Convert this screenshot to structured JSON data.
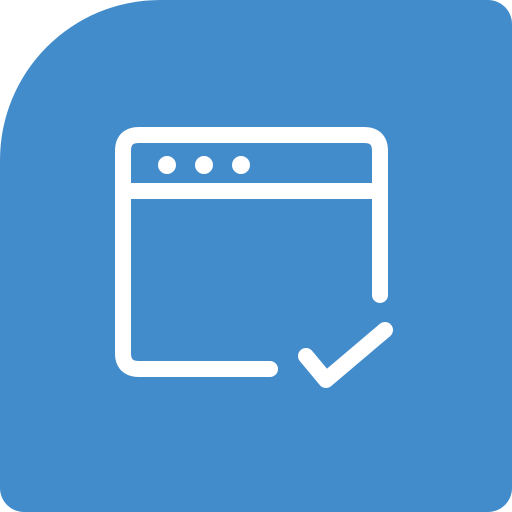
{
  "icon": {
    "name": "browser-window-checkmark-icon",
    "background_color": "#438ccb",
    "stroke_color": "#ffffff",
    "parts": [
      "window-frame-icon",
      "window-dot-icon",
      "window-dot-icon",
      "window-dot-icon",
      "checkmark-icon"
    ]
  }
}
